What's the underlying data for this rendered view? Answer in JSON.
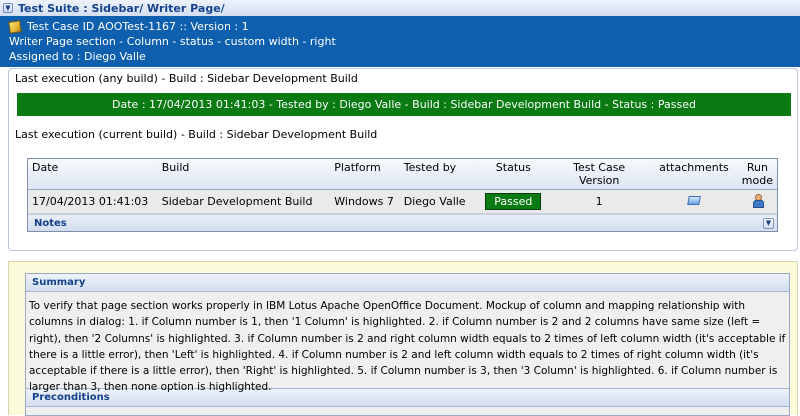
{
  "suite": {
    "title": "Test Suite : Sidebar/ Writer Page/"
  },
  "testcase": {
    "id_line": "Test Case ID AOOTest-1167 :: Version : 1",
    "name": "Writer Page section - Column - status - custom width - right",
    "assigned": "Assigned to : Diego Valle"
  },
  "last_any": {
    "title": "Last execution (any build) - Build : Sidebar Development Build",
    "banner": "Date : 17/04/2013 01:41:03 - Tested by : Diego Valle - Build : Sidebar Development Build - Status : Passed",
    "banner_color": "#0a7a12"
  },
  "last_current": {
    "title": "Last execution (current build) - Build : Sidebar Development Build"
  },
  "table": {
    "headers": {
      "date": "Date",
      "build": "Build",
      "platform": "Platform",
      "tested_by": "Tested by",
      "status": "Status",
      "version": "Test Case Version",
      "attachments": "attachments",
      "run_mode": "Run mode"
    },
    "row": {
      "date": "17/04/2013 01:41:03",
      "build": "Sidebar Development Build",
      "platform": "Windows 7",
      "tested_by": "Diego Valle",
      "status": "Passed",
      "version": "1"
    },
    "notes_label": "Notes"
  },
  "summary": {
    "label": "Summary",
    "text": "To verify that page section works properly in IBM Lotus Apache OpenOffice Document. Mockup of column and mapping relationship with columns in dialog: 1. if Column number is 1, then '1 Column' is highlighted. 2. if Column number is 2 and 2 columns have same size (left = right), then '2 Columns' is highlighted. 3. if Column number is 2 and right column width equals to 2 times of left column width (it's acceptable if there is a little error), then 'Left' is highlighted. 4. if Column number is 2 and left column width equals to 2 times of right column width (it's acceptable if there is a little error), then 'Right' is highlighted. 5. if Column number is 3, then '3 Column' is highlighted. 6. if Column number is larger than 3, then none option is highlighted."
  },
  "preconditions": {
    "label": "Preconditions"
  },
  "icons": {
    "toggle": "triangle-down-icon",
    "edit": "pencil-icon",
    "attachment": "attachment-icon",
    "run_mode": "manual-run-icon",
    "notes_toggle": "chevron-down-icon"
  }
}
